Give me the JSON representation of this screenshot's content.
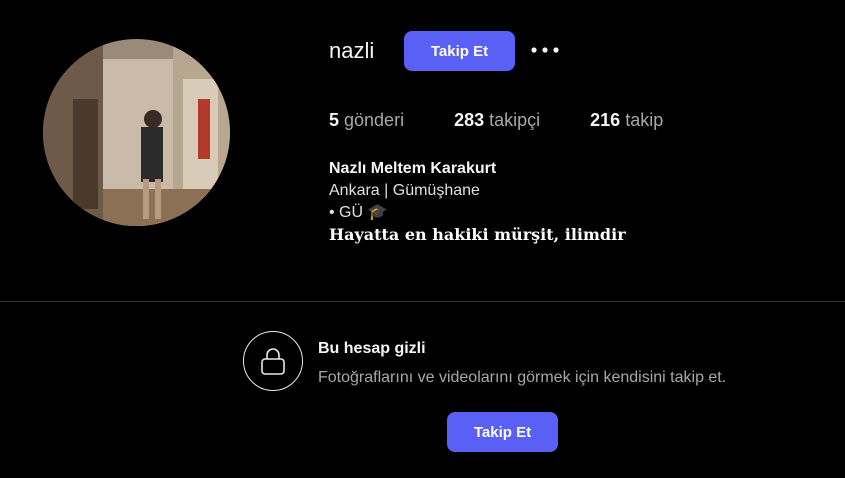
{
  "profile": {
    "username": "nazli",
    "follow_label": "Takip Et",
    "stats": [
      {
        "count": "5",
        "label": "gönderi"
      },
      {
        "count": "283",
        "label": "takipçi"
      },
      {
        "count": "216",
        "label": "takip"
      }
    ],
    "bio": {
      "full_name": "Nazlı Meltem Karakurt",
      "location": "Ankara | Gümüşhane",
      "school": "• GÜ 🎓",
      "quote": "Hayatta en hakiki mürşit, ilimdir"
    }
  },
  "private_notice": {
    "title": "Bu hesap gizli",
    "subtitle": "Fotoğraflarını ve videolarını görmek için kendisini takip et.",
    "follow_label": "Takip Et"
  },
  "colors": {
    "background": "#000000",
    "accent": "#5a5ff6",
    "muted_text": "#a8a8a8",
    "divider": "#333333"
  },
  "icons": {
    "more": "more-options-icon",
    "lock": "lock-icon"
  }
}
